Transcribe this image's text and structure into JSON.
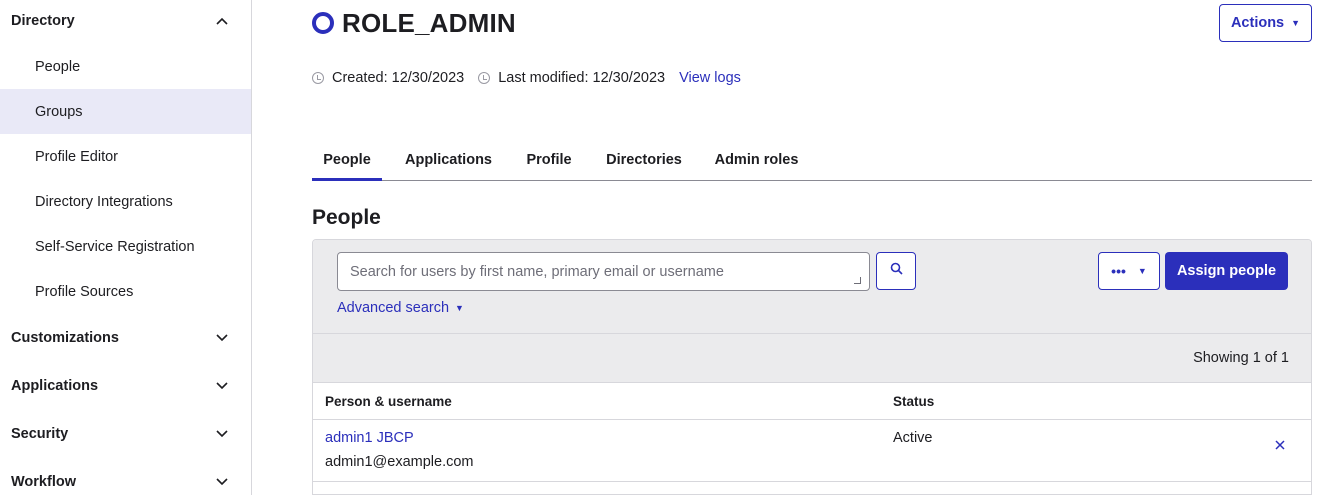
{
  "sidebar": {
    "sections": [
      {
        "label": "Directory",
        "expanded": true
      },
      {
        "label": "Customizations",
        "expanded": false
      },
      {
        "label": "Applications",
        "expanded": false
      },
      {
        "label": "Security",
        "expanded": false
      },
      {
        "label": "Workflow",
        "expanded": false
      }
    ],
    "directory_items": [
      {
        "label": "People",
        "active": false
      },
      {
        "label": "Groups",
        "active": true
      },
      {
        "label": "Profile Editor",
        "active": false
      },
      {
        "label": "Directory Integrations",
        "active": false
      },
      {
        "label": "Self-Service Registration",
        "active": false
      },
      {
        "label": "Profile Sources",
        "active": false
      }
    ]
  },
  "header": {
    "title": "ROLE_ADMIN",
    "actions_label": "Actions",
    "created": "Created: 12/30/2023",
    "modified": "Last modified: 12/30/2023",
    "view_logs": "View logs"
  },
  "tabs": [
    {
      "label": "People",
      "active": true
    },
    {
      "label": "Applications",
      "active": false
    },
    {
      "label": "Profile",
      "active": false
    },
    {
      "label": "Directories",
      "active": false
    },
    {
      "label": "Admin roles",
      "active": false
    }
  ],
  "people": {
    "title": "People",
    "search_placeholder": "Search for users by first name, primary email or username",
    "advanced_search": "Advanced search",
    "more_label": "•••",
    "assign_label": "Assign people",
    "showing": "Showing 1 of 1",
    "columns": [
      "Person & username",
      "Status"
    ],
    "rows": [
      {
        "name": "admin1 JBCP",
        "email": "admin1@example.com",
        "status": "Active"
      }
    ]
  },
  "colors": {
    "accent": "#2b2fbb",
    "active_bg": "#e9e9f7",
    "toolbar_bg": "#ebebed"
  }
}
